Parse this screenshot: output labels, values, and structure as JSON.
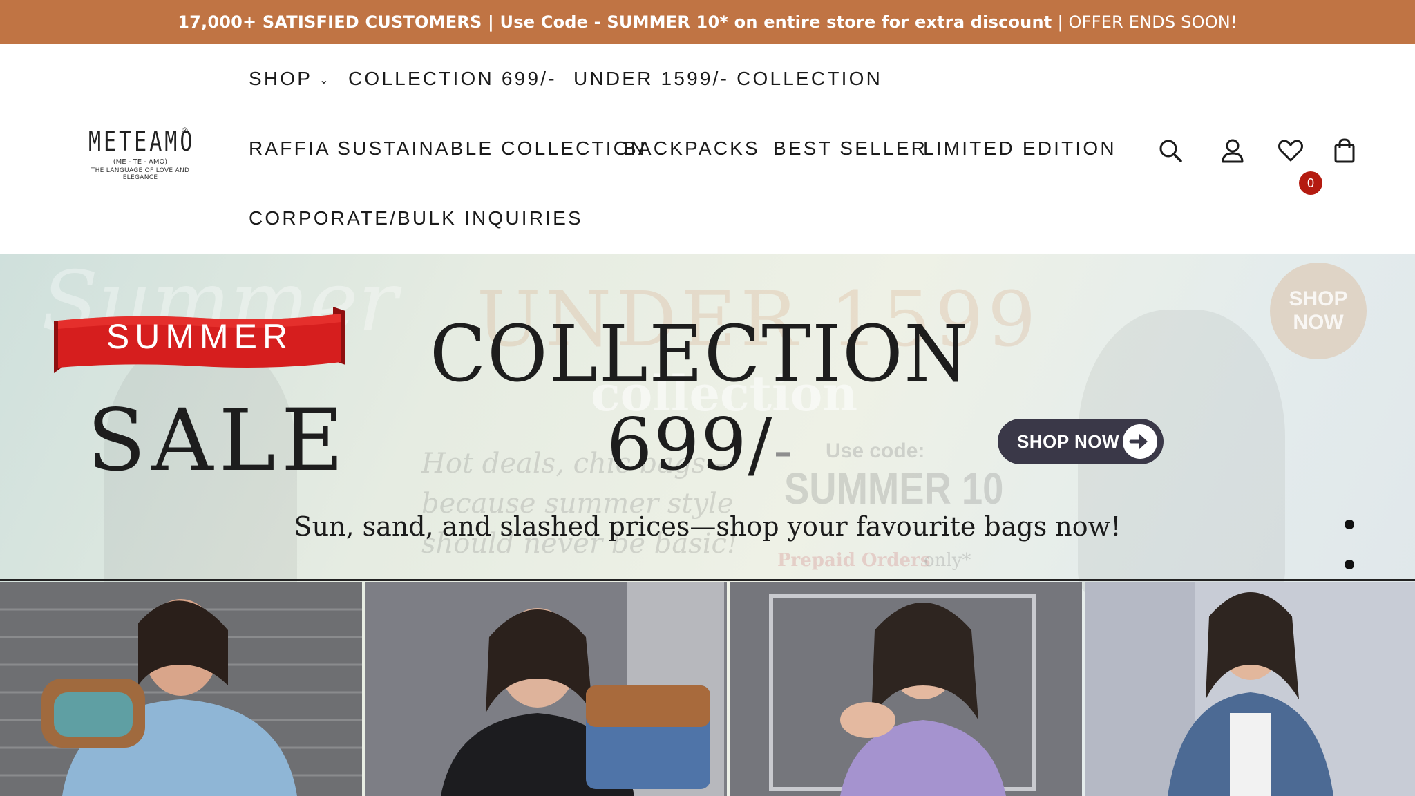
{
  "announcement": {
    "bold_text": "17,000+ SATISFIED CUSTOMERS | Use Code - SUMMER 10* on entire store for extra discount",
    "light_text": "| OFFER ENDS SOON!"
  },
  "logo": {
    "wordmark": "METEAMO",
    "registered": "®",
    "pronunciation": "(ME - TE - AMO)",
    "tagline": "THE LANGUAGE OF LOVE AND ELEGANCE"
  },
  "nav": {
    "shop": "SHOP",
    "collection_699": "COLLECTION 699/-",
    "under_1599": "UNDER 1599/- COLLECTION",
    "raffia": "RAFFIA SUSTAINABLE COLLECTION",
    "backpacks": "BACKPACKS",
    "best_seller": "BEST SELLER",
    "limited_edition": "LIMITED EDITION",
    "corporate": "CORPORATE/BULK INQUIRIES"
  },
  "header_icons": {
    "search": "search-icon",
    "account": "user-icon",
    "wishlist": "heart-icon",
    "cart": "bag-icon",
    "wishlist_count": "0"
  },
  "hero": {
    "ribbon": "SUMMER",
    "sale": "SALE",
    "collection": "COLLECTION",
    "price": "699/",
    "price_dash": "-",
    "tagline": "Sun, sand, and slashed prices—shop your favourite bags now!",
    "cta": "SHOP NOW",
    "background_text": {
      "summer": "Summer",
      "under": "UNDER 1599",
      "collection": "collection",
      "hot_deals": "Hot deals, chic bags—",
      "because": "because summer style",
      "should": "should never be basic!",
      "use_code": "Use code:",
      "code": "SUMMER 10",
      "prepaid": "Prepaid Orders",
      "only": "only*",
      "shop_now_badge": "SHOP NOW"
    },
    "slides_count": 4
  },
  "colors": {
    "announcement_bg": "#c07444",
    "ribbon_red": "#d61e1e",
    "button_dark": "#3a3848",
    "badge_red": "#b41b10"
  }
}
